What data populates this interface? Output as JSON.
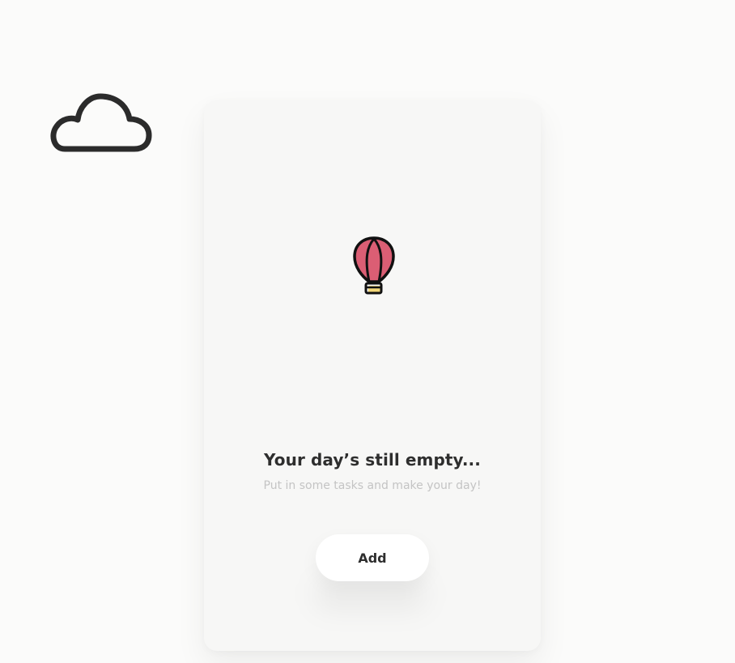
{
  "icons": {
    "cloud": "cloud-icon",
    "balloon": "hot-air-balloon-icon"
  },
  "empty_state": {
    "title": "Your day’s still empty...",
    "subtitle": "Put in some tasks and make your day!"
  },
  "actions": {
    "add_label": "Add"
  },
  "colors": {
    "background": "#fbfbfa",
    "card": "#f7f7f6",
    "balloon_fill": "#db5e74",
    "balloon_basket": "#f2d36b",
    "text_primary": "#2e2e2e",
    "text_secondary": "#c4c4c4",
    "button": "#ffffff"
  }
}
